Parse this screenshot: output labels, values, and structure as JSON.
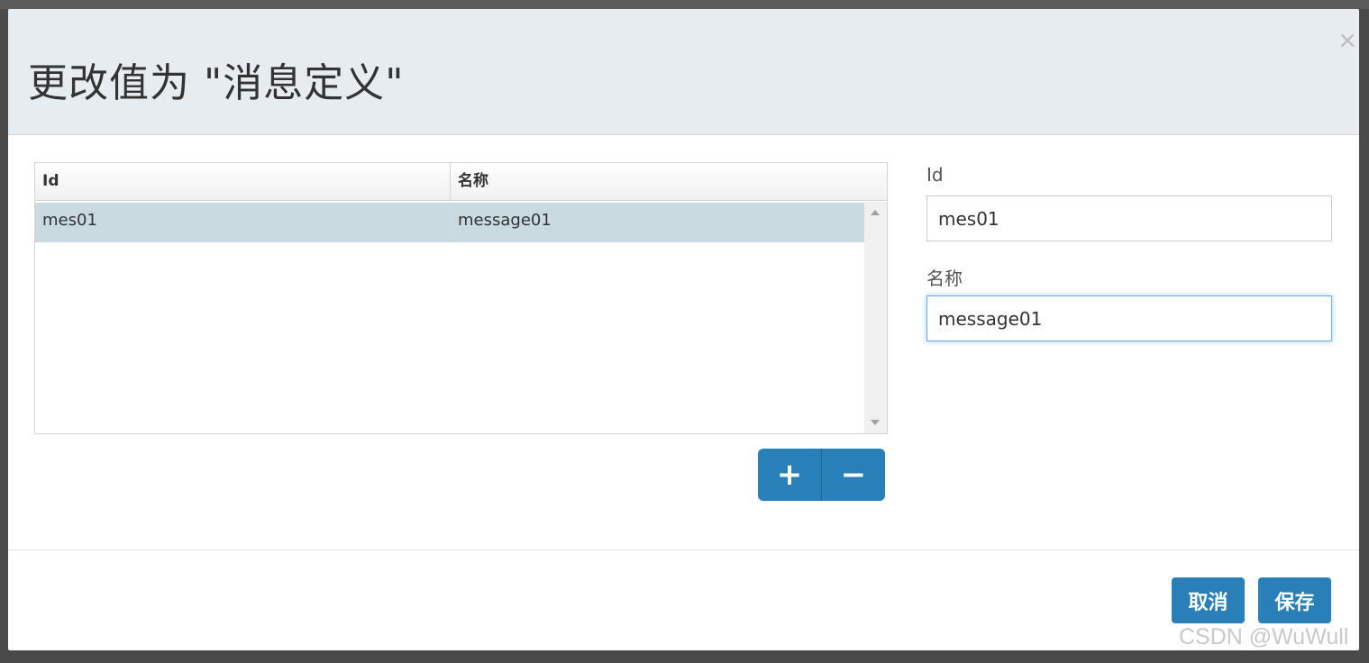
{
  "dialog": {
    "title": "更改值为 \"消息定义\"",
    "close_glyph": "×"
  },
  "grid": {
    "columns": [
      "Id",
      "名称"
    ],
    "rows": [
      {
        "id": "mes01",
        "name": "message01"
      }
    ]
  },
  "grid_buttons": {
    "add_glyph": "+",
    "remove_glyph": "−"
  },
  "form": {
    "id_label": "Id",
    "id_value": "mes01",
    "name_label": "名称",
    "name_value": "message01"
  },
  "footer": {
    "cancel_label": "取消",
    "save_label": "保存"
  },
  "watermark": "CSDN @WuWull",
  "colors": {
    "accent": "#2980b9",
    "header_bg": "#e7ecf0",
    "selected_row": "#c9dbe0"
  }
}
